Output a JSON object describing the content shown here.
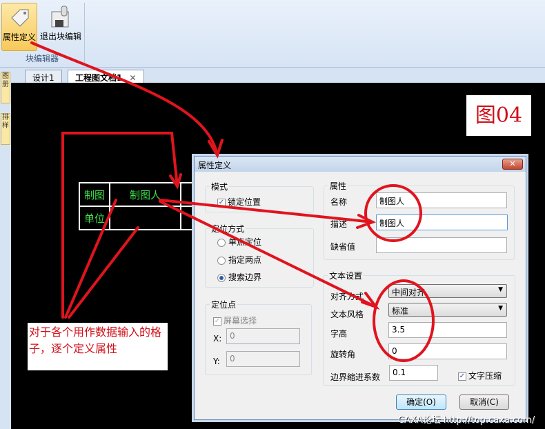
{
  "ribbon": {
    "attr_def": "属性定义",
    "exit_block": "退出块编辑",
    "group": "块编辑器"
  },
  "sidebar": {
    "tab1": "图册",
    "tab2": "排样"
  },
  "tabs": [
    {
      "label": "设计1"
    },
    {
      "label": "工程图文档1"
    }
  ],
  "cad_table": {
    "r1c1": "制图",
    "r1c2": "制图人",
    "r2c1": "单位"
  },
  "figure_label": "图04",
  "note": "对于各个用作数据输入的格子，逐个定义属性",
  "dialog": {
    "title": "属性定义",
    "mode": {
      "legend": "模式",
      "lock_position": "锁定位置",
      "lock_checked": true
    },
    "position_method": {
      "legend": "定位方式",
      "options": [
        "单点定位",
        "指定两点",
        "搜索边界"
      ],
      "selected": "搜索边界"
    },
    "position_point": {
      "legend": "定位点",
      "screen_select": "屏幕选择",
      "x_label": "X:",
      "x": "0",
      "y_label": "Y:",
      "y": "0"
    },
    "attributes": {
      "legend": "属性",
      "name_label": "名称",
      "name": "制图人",
      "desc_label": "描述",
      "desc": "制图人",
      "default_label": "缺省值",
      "default": ""
    },
    "text": {
      "legend": "文本设置",
      "align_label": "对齐方式",
      "align": "中间对齐",
      "style_label": "文本风格",
      "style": "标准",
      "height_label": "字高",
      "height": "3.5",
      "rotation_label": "旋转角",
      "rotation": "0",
      "indent_label": "边界缩进系数",
      "indent": "0.1",
      "compress_label": "文字压缩",
      "compress_checked": true
    },
    "ok": "确定(O)",
    "cancel": "取消(C)"
  },
  "watermark": "CAXA论坛 http://top.caxa.com/"
}
